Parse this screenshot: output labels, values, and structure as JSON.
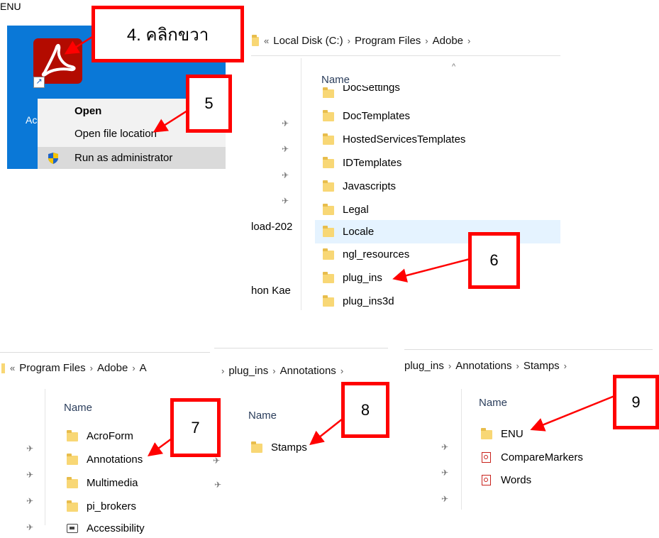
{
  "top_left_fragment": "ENU",
  "shortcut": {
    "label_fragment": "Ac",
    "menu": {
      "open": "Open",
      "open_file_location": "Open file location",
      "run_as_admin": "Run as administrator"
    }
  },
  "annotations": {
    "step4": "4. คลิกขวา",
    "step5": "5",
    "step6": "6",
    "step7": "7",
    "step8": "8",
    "step9": "9"
  },
  "explorer1": {
    "breadcrumb": [
      "Local Disk (C:)",
      "Program Files",
      "Adobe"
    ],
    "column_header": "Name",
    "items": [
      "DocSettings",
      "DocTemplates",
      "HostedServicesTemplates",
      "IDTemplates",
      "Javascripts",
      "Legal",
      "Locale",
      "ngl_resources",
      "plug_ins",
      "plug_ins3d"
    ],
    "sidebar_fragments": [
      "load-202",
      "hon Kae"
    ]
  },
  "explorer2": {
    "breadcrumb": [
      "Program Files",
      "Adobe",
      "A"
    ],
    "column_header": "Name",
    "items": [
      "AcroForm",
      "Annotations",
      "Multimedia",
      "pi_brokers",
      "Accessibility"
    ]
  },
  "explorer3": {
    "breadcrumb": [
      "plug_ins",
      "Annotations"
    ],
    "column_header": "Name",
    "items": [
      "Stamps"
    ]
  },
  "explorer4": {
    "breadcrumb": [
      "plug_ins",
      "Annotations",
      "Stamps"
    ],
    "column_header": "Name",
    "items": [
      {
        "name": "ENU",
        "icon": "folder-icon"
      },
      {
        "name": "CompareMarkers",
        "icon": "pdf-file-icon"
      },
      {
        "name": "Words",
        "icon": "pdf-file-icon"
      }
    ]
  },
  "colors": {
    "desktop_blue": "#0a78d7",
    "acrobat_red": "#b30b00",
    "annotation_red": "#ff0000",
    "highlight": "#e5f3ff",
    "folder_yellow": "#f8d775"
  }
}
